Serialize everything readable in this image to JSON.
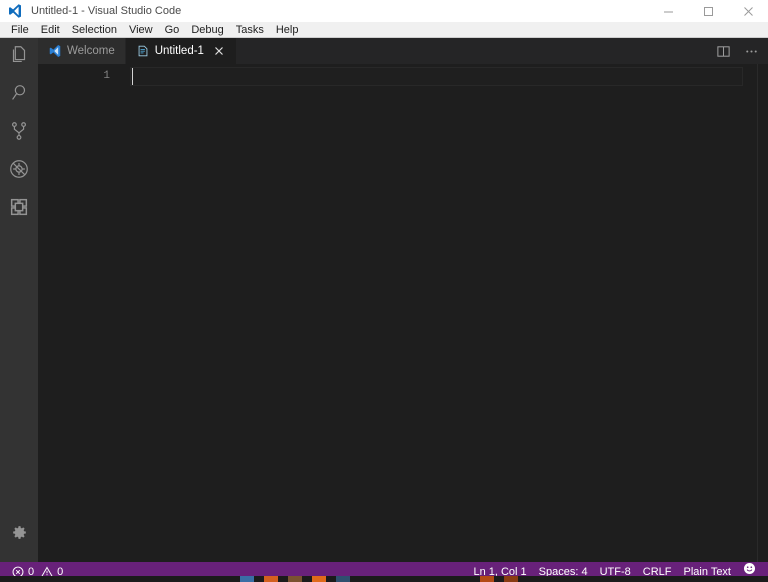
{
  "window": {
    "title": "Untitled-1 - Visual Studio Code",
    "app_icon": "vscode-logo-icon",
    "controls": {
      "minimize": "–",
      "maximize": "□",
      "close": "✕"
    }
  },
  "menubar": {
    "items": [
      {
        "label": "File"
      },
      {
        "label": "Edit"
      },
      {
        "label": "Selection"
      },
      {
        "label": "View"
      },
      {
        "label": "Go"
      },
      {
        "label": "Debug"
      },
      {
        "label": "Tasks"
      },
      {
        "label": "Help"
      }
    ]
  },
  "activitybar": {
    "items": [
      {
        "name": "explorer",
        "icon": "files-icon",
        "title": "Explorer"
      },
      {
        "name": "search",
        "icon": "search-icon",
        "title": "Search"
      },
      {
        "name": "source-control",
        "icon": "source-control-icon",
        "title": "Source Control"
      },
      {
        "name": "debug",
        "icon": "debug-icon",
        "title": "Debug"
      },
      {
        "name": "extensions",
        "icon": "extensions-icon",
        "title": "Extensions"
      }
    ],
    "bottom": [
      {
        "name": "manage",
        "icon": "gear-icon",
        "title": "Manage"
      }
    ]
  },
  "tabs": [
    {
      "label": "Welcome",
      "icon": "vscode-logo-icon",
      "active": false,
      "closable": false
    },
    {
      "label": "Untitled-1",
      "icon": "file-text-icon",
      "active": true,
      "closable": true,
      "close_glyph": "✕"
    }
  ],
  "editor_actions": [
    {
      "name": "split-editor",
      "icon": "split-editor-icon"
    },
    {
      "name": "more-actions",
      "icon": "ellipsis-icon",
      "glyph": "⋯"
    }
  ],
  "editor": {
    "line_number": "1",
    "content": "",
    "cursor_line": 1,
    "cursor_column": 1
  },
  "statusbar": {
    "left": [
      {
        "name": "errors",
        "icon": "error-icon",
        "label": "0"
      },
      {
        "name": "warnings",
        "icon": "warning-icon",
        "label": "0"
      }
    ],
    "right": [
      {
        "name": "cursor-position",
        "label": "Ln 1, Col 1"
      },
      {
        "name": "indentation",
        "label": "Spaces: 4"
      },
      {
        "name": "encoding",
        "label": "UTF-8"
      },
      {
        "name": "eol",
        "label": "CRLF"
      },
      {
        "name": "language-mode",
        "label": "Plain Text"
      },
      {
        "name": "feedback",
        "label": "",
        "icon": "smiley-icon"
      }
    ]
  },
  "colors": {
    "titlebar_bg": "#ffffff",
    "menubar_bg": "#f0f0f0",
    "activitybar_bg": "#333333",
    "tabbar_bg": "#252526",
    "tab_inactive_bg": "#2d2d2d",
    "editor_bg": "#1e1e1e",
    "statusbar_bg": "#68217a",
    "accent_blue": "#0f6cbd",
    "text_light": "#cccccc"
  }
}
